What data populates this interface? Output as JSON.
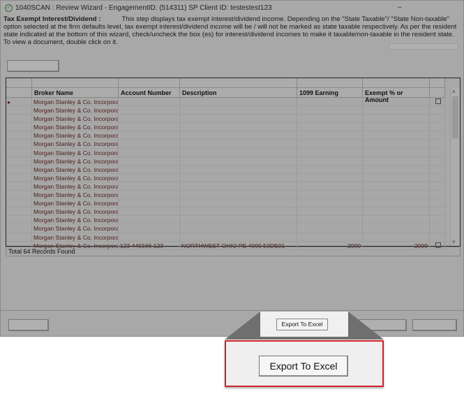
{
  "window": {
    "title": "1040SCAN : Review Wizard - EngagementID: (514311)  SP Client ID: testestest123",
    "minimize": "–"
  },
  "description": {
    "heading": "Tax Exempt Interest/Dividend :",
    "text": "This step displays tax exempt interest/dividend income. Depending on the \"State Taxable\"/ \"State Non-taxable\" option selected at the firm defaults level, tax exempt interest/dividend income will be / will not be marked as state taxable respectively. As per the resident state indicated at the bottom of this wizard, check/uncheck the box (es) for interest/dividend incomes to make it taxable/non-taxable in the resident state. To view a document, double click on it."
  },
  "grid": {
    "columns": [
      "Broker Name",
      "Account Number",
      "Description",
      "1099 Earning",
      "Exempt % or Amount"
    ],
    "broker": "Morgan Stanley & Co. Incorporat",
    "row_count": 18,
    "last_row": {
      "broker": "Morgan Stanley & Co. Incorporat",
      "account": "123 445566 123",
      "description": "NORTHWEST OHIO PE 4000 50DE01",
      "earning": "2000",
      "exempt": "2000"
    }
  },
  "status": "Total 64 Records Found",
  "buttons": {
    "export_small": "Export To Excel",
    "export_big": "Export To Excel"
  }
}
